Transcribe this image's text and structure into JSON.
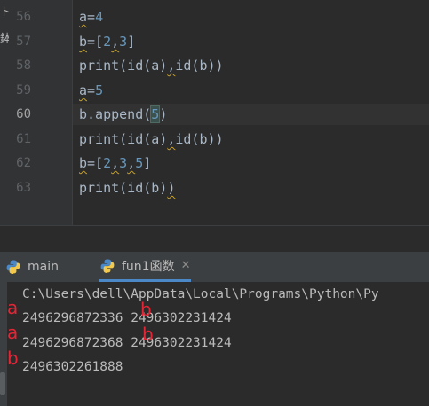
{
  "side_strip": {
    "glyph_top": "ト",
    "glyph_bottom": "鉢"
  },
  "editor": {
    "line_numbers": [
      "56",
      "57",
      "58",
      "59",
      "60",
      "61",
      "62",
      "63"
    ],
    "current_line": "60"
  },
  "code": {
    "l56": {
      "var": "a",
      "eq": "=",
      "num": "4"
    },
    "l57": {
      "var": "b",
      "eq": "=[",
      "n1": "2",
      "comma": ",",
      "n2": "3",
      "close": "]"
    },
    "l58": {
      "fn": "print(id(a)",
      "comma": ",",
      "rest": "id(b))"
    },
    "l59": {
      "var": "a",
      "eq": "=",
      "num": "5"
    },
    "l60": {
      "text": "b.append(",
      "num": "5",
      "close": ")"
    },
    "l61": {
      "fn": "print(id(a)",
      "comma": ",",
      "rest": "id(b))"
    },
    "l62": {
      "var": "b",
      "eq": "=[",
      "n1": "2",
      "c1": ",",
      "n2": "3",
      "c2": ",",
      "n3": "5",
      "close": "]"
    },
    "l63": {
      "fn": "print(id(b)",
      "close": ")"
    }
  },
  "tabs": [
    {
      "label": "main",
      "icon": "python-icon"
    },
    {
      "label": "fun1函数",
      "icon": "python-icon",
      "close": "✕"
    }
  ],
  "output": {
    "path_line": "C:\\Users\\dell\\AppData\\Local\\Programs\\Python\\Py",
    "line1": "2496296872336 2496302231424",
    "line2": "2496296872368 2496302231424",
    "line3": "2496302261888"
  },
  "annotations": {
    "a1": "a",
    "b1": "b",
    "a2": "a",
    "b2": "b",
    "b3": "b"
  },
  "colors": {
    "background": "#2b2b2b",
    "gutter": "#313335",
    "number": "#6897bb",
    "text": "#a9b7c6",
    "annotation": "#e32636",
    "tab_underline": "#4a88c7"
  }
}
